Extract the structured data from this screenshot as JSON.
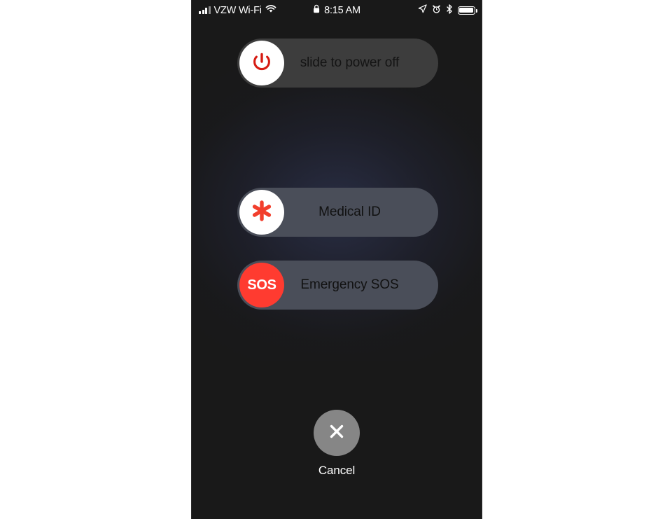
{
  "status_bar": {
    "signal_icon": "cellular-signal-icon",
    "carrier": "VZW Wi-Fi",
    "wifi_icon": "wifi-icon",
    "lock_icon": "lock-icon",
    "time": "8:15 AM",
    "location_icon": "location-arrow-icon",
    "alarm_icon": "alarm-clock-icon",
    "bluetooth_icon": "bluetooth-icon",
    "battery_icon": "battery-icon"
  },
  "sliders": [
    {
      "key": "power_off",
      "label": "slide to power off",
      "icon": "power-icon",
      "knob_color": "#ffffff",
      "icon_color": "#d61b12",
      "track_color": "#3d3d3d"
    },
    {
      "key": "medical_id",
      "label": "Medical ID",
      "icon": "medical-asterisk-icon",
      "knob_color": "#ffffff",
      "icon_color": "#f23e2c",
      "track_color": "#4a4e59"
    },
    {
      "key": "emergency_sos",
      "label": "Emergency SOS",
      "icon": "sos-icon",
      "icon_text": "SOS",
      "knob_color": "#ff3b30",
      "icon_color": "#ffffff",
      "track_color": "#4a4e59"
    }
  ],
  "cancel": {
    "label": "Cancel",
    "icon": "close-x-icon",
    "circle_color": "#868686"
  },
  "theme": {
    "screen_background": "#191919",
    "glow_color": "#2e3452",
    "page_background": "#ffffff"
  }
}
